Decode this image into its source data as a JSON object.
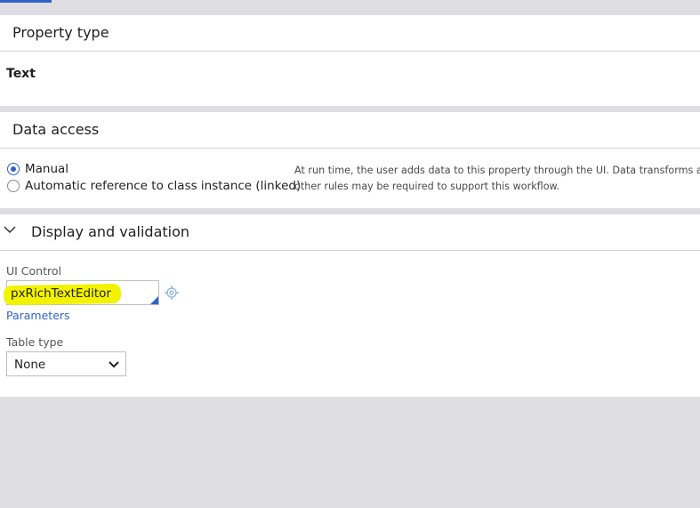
{
  "property_type": {
    "title": "Property type",
    "value": "Text"
  },
  "data_access": {
    "title": "Data access",
    "options": [
      {
        "label": "Manual",
        "selected": true
      },
      {
        "label": "Automatic reference to class instance (linked)",
        "selected": false
      }
    ],
    "help_line1": "At run time, the user adds data to this property through the UI. Data transforms and",
    "help_line2": "other rules may be required to support this workflow."
  },
  "display_validation": {
    "title": "Display and validation",
    "ui_control_label": "UI Control",
    "ui_control_value": "pxRichTextEditor",
    "parameters_link": "Parameters",
    "table_type_label": "Table type",
    "table_type_value": "None"
  },
  "icons": {
    "collapse": "chevron-down-icon",
    "settings": "gear-icon",
    "select": "chevron-down-icon"
  },
  "colors": {
    "accent": "#2f62c9",
    "highlight": "#f3f300",
    "background": "#dddde2"
  }
}
